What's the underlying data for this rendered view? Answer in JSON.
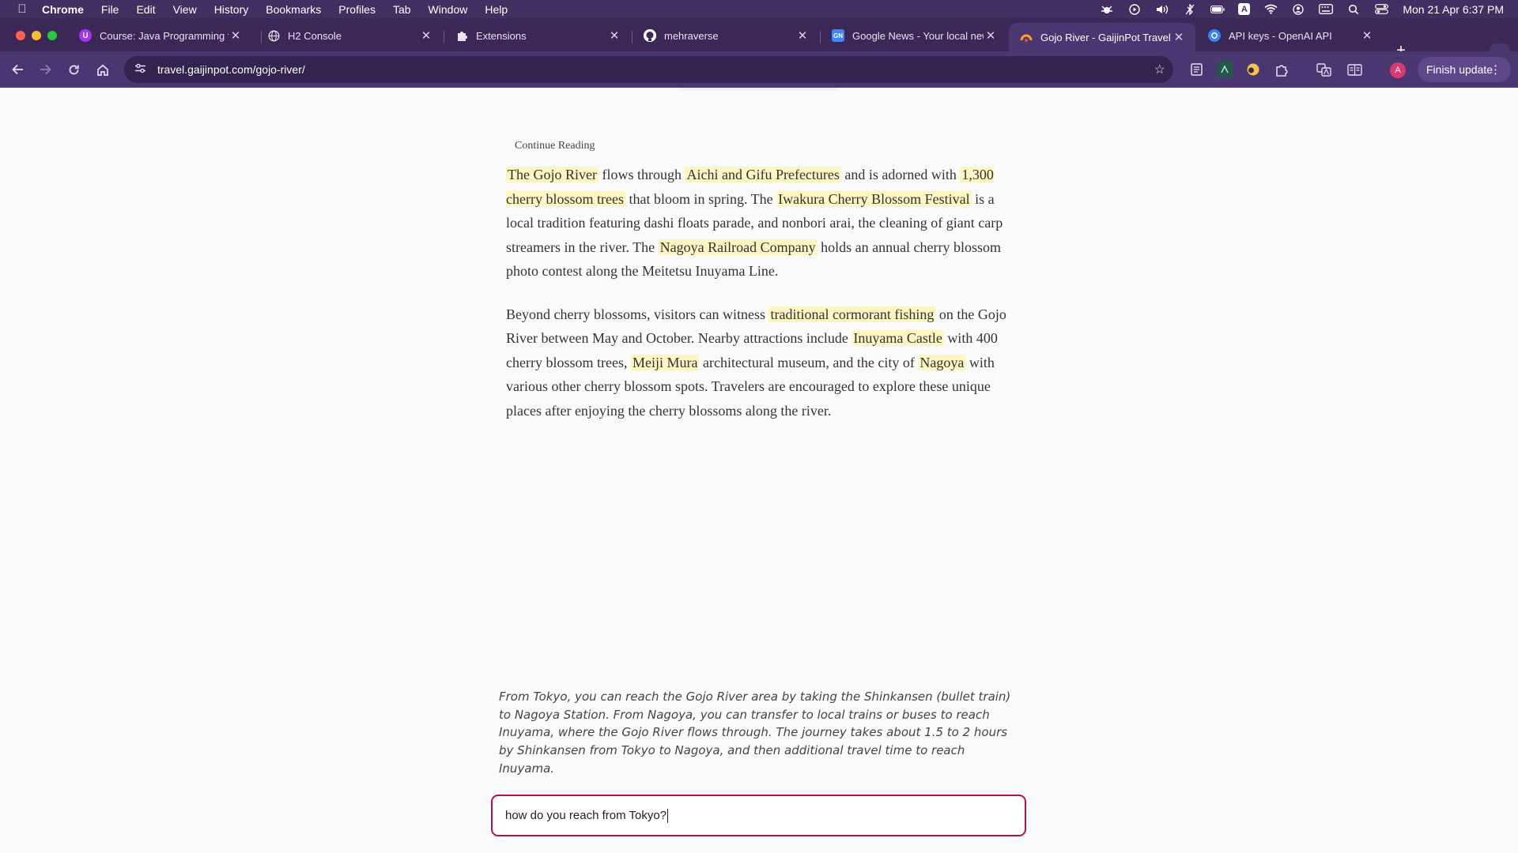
{
  "menubar": {
    "app": "Chrome",
    "items": [
      "File",
      "Edit",
      "View",
      "History",
      "Bookmarks",
      "Profiles",
      "Tab",
      "Window",
      "Help"
    ],
    "clock": "Mon 21 Apr  6:37 PM",
    "input_source": "A"
  },
  "tabs": [
    {
      "title": "Course: Java Programming fo",
      "favicon": "udemy-icon",
      "favicon_text": "U",
      "active": false
    },
    {
      "title": "H2 Console",
      "favicon": "globe-icon",
      "active": false
    },
    {
      "title": "Extensions",
      "favicon": "puzzle-icon",
      "active": false
    },
    {
      "title": "mehraverse",
      "favicon": "github-icon",
      "active": false
    },
    {
      "title": "Google News - Your local new",
      "favicon": "google-news-icon",
      "favicon_text": "GN",
      "active": false
    },
    {
      "title": "Gojo River - GaijinPot Travel",
      "favicon": "gaijinpot-icon",
      "active": true
    },
    {
      "title": "API keys - OpenAI API",
      "favicon": "openai-icon",
      "active": false
    }
  ],
  "toolbar": {
    "url": "travel.gaijinpot.com/gojo-river/",
    "avatar_letter": "A",
    "finish_update": "Finish update"
  },
  "article": {
    "continue_reading": "Continue Reading",
    "p1": {
      "s1": "The Gojo River",
      "t1": " flows through ",
      "s2": "Aichi and Gifu Prefectures",
      "t2": " and is adorned with ",
      "s3": "1,300 cherry blossom trees",
      "t3": " that bloom in spring. The ",
      "s4": "Iwakura Cherry Blossom Festival",
      "t4": " is a local tradition featuring dashi floats parade, and nonbori arai, the cleaning of giant carp streamers in the river. The ",
      "s5": "Nagoya Railroad Company",
      "t5": " holds an annual cherry blossom photo contest along the Meitetsu Inuyama Line."
    },
    "p2": {
      "t1": "Beyond cherry blossoms, visitors can witness ",
      "s1": "traditional cormorant fishing",
      "t2": " on the Gojo River between May and October. Nearby attractions include ",
      "s2": "Inuyama Castle",
      "t3": " with 400 cherry blossom trees, ",
      "s3": "Meiji Mura",
      "t4": " architectural museum, and the city of ",
      "s4": "Nagoya",
      "t5": " with various other cherry blossom spots. Travelers are encouraged to explore these unique places after enjoying the cherry blossoms along the river."
    }
  },
  "assistant": {
    "answer": "From Tokyo, you can reach the Gojo River area by taking the Shinkansen (bullet train) to Nagoya Station. From Nagoya, you can transfer to local trains or buses to reach Inuyama, where the Gojo River flows through. The journey takes about 1.5 to 2 hours by Shinkansen from Tokyo to Nagoya, and then additional travel time to reach Inuyama.",
    "query": "how do you reach from Tokyo?"
  },
  "colors": {
    "menubar": "#412f62",
    "tabstrip": "#3b2856",
    "toolbar": "#4a3670",
    "highlight": "#fdf5c2",
    "input_border": "#b2123f"
  }
}
